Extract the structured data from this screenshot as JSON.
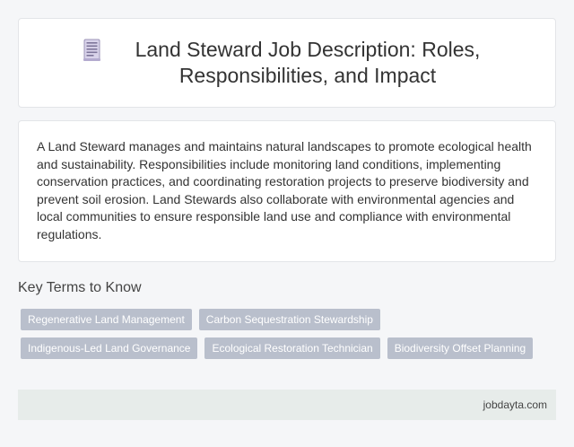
{
  "header": {
    "icon": "document-icon",
    "title": "Land Steward Job Description: Roles, Responsibilities, and Impact"
  },
  "description": "A Land Steward manages and maintains natural landscapes to promote ecological health and sustainability. Responsibilities include monitoring land conditions, implementing conservation practices, and coordinating restoration projects to preserve biodiversity and prevent soil erosion. Land Stewards also collaborate with environmental agencies and local communities to ensure responsible land use and compliance with environmental regulations.",
  "key_terms": {
    "heading": "Key Terms to Know",
    "rows": [
      [
        "Regenerative Land Management",
        "Carbon Sequestration Stewardship"
      ],
      [
        "Indigenous-Led Land Governance",
        "Ecological Restoration Technician",
        "Biodiversity Offset Planning"
      ]
    ]
  },
  "footer": {
    "site": "jobdayta.com"
  }
}
